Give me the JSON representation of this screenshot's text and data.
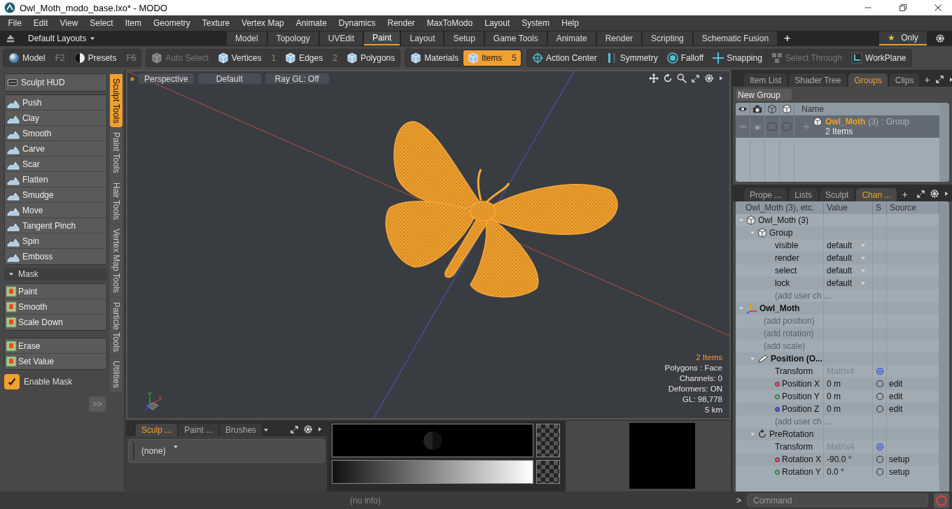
{
  "window": {
    "title": "Owl_Moth_modo_base.lxo* - MODO"
  },
  "menu": [
    "File",
    "Edit",
    "View",
    "Select",
    "Item",
    "Geometry",
    "Texture",
    "Vertex Map",
    "Animate",
    "Dynamics",
    "Render",
    "MaxToModo",
    "Layout",
    "System",
    "Help"
  ],
  "layout_bar": {
    "layouts": "Default Layouts",
    "tabs": [
      {
        "label": "Model",
        "selected": false
      },
      {
        "label": "Topology",
        "selected": false
      },
      {
        "label": "UVEdit",
        "selected": false
      },
      {
        "label": "Paint",
        "selected": true
      },
      {
        "label": "Layout",
        "selected": false
      },
      {
        "label": "Setup",
        "selected": false
      },
      {
        "label": "Game Tools",
        "selected": false
      },
      {
        "label": "Animate",
        "selected": false
      },
      {
        "label": "Render",
        "selected": false
      },
      {
        "label": "Scripting",
        "selected": false
      },
      {
        "label": "Schematic Fusion",
        "selected": false
      }
    ],
    "add": "+",
    "filter": {
      "star": "★",
      "label": "Only",
      "selected": true
    }
  },
  "toolbar": [
    {
      "buttons": [
        {
          "label": "Model",
          "shortcut": "F2",
          "selected": false,
          "disabled": false
        },
        {
          "label": "Presets",
          "shortcut": "F6",
          "selected": false,
          "disabled": false
        }
      ]
    },
    {
      "buttons": [
        {
          "label": "Auto Select",
          "selected": false,
          "disabled": true
        },
        {
          "label": "Vertices",
          "shortcut": "1",
          "selected": false,
          "disabled": false
        },
        {
          "label": "Edges",
          "shortcut": "2",
          "selected": false,
          "disabled": false
        },
        {
          "label": "Polygons",
          "selected": false,
          "disabled": false
        }
      ]
    },
    {
      "buttons": [
        {
          "label": "Materials",
          "selected": false,
          "disabled": false
        },
        {
          "label": "Items",
          "shortcut": "5",
          "selected": true,
          "disabled": false
        }
      ]
    },
    {
      "buttons": [
        {
          "label": "Action Center",
          "selected": false,
          "disabled": false
        },
        {
          "label": "Symmetry",
          "selected": false,
          "disabled": false
        },
        {
          "label": "Falloff",
          "selected": false,
          "disabled": false
        },
        {
          "label": "Snapping",
          "selected": false,
          "disabled": false
        },
        {
          "label": "Select Through",
          "selected": false,
          "disabled": true
        },
        {
          "label": "WorkPlane",
          "selected": false,
          "disabled": false
        }
      ]
    }
  ],
  "sculpt_panel": {
    "hud": "Sculpt HUD",
    "tools": [
      "Push",
      "Clay",
      "Smooth",
      "Carve",
      "Scar",
      "Flatten",
      "Smudge",
      "Move",
      "Tangent Pinch",
      "Spin",
      "Emboss"
    ],
    "mask": {
      "label": "Mask",
      "expanded": true,
      "tools": [
        "Paint",
        "Smooth",
        "Scale Down"
      ]
    },
    "value_tools": [
      "Erase",
      "Set Value"
    ],
    "enable_mask": {
      "label": "Enable Mask",
      "checked": true
    },
    "more": ">>"
  },
  "tool_tabs": [
    {
      "label": "Sculpt Tools",
      "selected": true
    },
    {
      "label": "Paint Tools",
      "selected": false
    },
    {
      "label": "Hair Tools",
      "selected": false
    },
    {
      "label": "Vertex Map Tools",
      "selected": false
    },
    {
      "label": "Particle Tools",
      "selected": false
    },
    {
      "label": "Utilities",
      "selected": false
    }
  ],
  "viewport": {
    "buttons": [
      "Perspective",
      "Default",
      "Ray GL: Off"
    ],
    "gizmo": [
      "Y",
      "X"
    ],
    "info": [
      {
        "text": "2 Items",
        "highlight": true
      },
      {
        "text": "Polygons : Face",
        "highlight": false
      },
      {
        "text": "Channels: 0",
        "highlight": false
      },
      {
        "text": "Deformers: ON",
        "highlight": false
      },
      {
        "text": "GL: 98,778",
        "highlight": false
      },
      {
        "text": "5 km",
        "highlight": false
      }
    ]
  },
  "brush_panel": {
    "tabs": [
      {
        "label": "Sculp ...",
        "selected": true
      },
      {
        "label": "Paint ...",
        "selected": false
      },
      {
        "label": "Brushes",
        "selected": false
      }
    ],
    "brush": "(none)"
  },
  "groups_panel": {
    "tabs": [
      {
        "label": "Item List",
        "selected": false
      },
      {
        "label": "Shader Tree",
        "selected": false
      },
      {
        "label": "Groups",
        "selected": true
      },
      {
        "label": "Clips",
        "selected": false
      }
    ],
    "add": "+",
    "new_group": "New Group",
    "column": "Name",
    "rows": [
      {
        "name": "Owl_Moth",
        "count": "(3)",
        "type": ": Group",
        "detail": "2 Items"
      }
    ]
  },
  "channels_panel": {
    "tabs": [
      {
        "label": "Prope ...",
        "selected": false
      },
      {
        "label": "Lists",
        "selected": false
      },
      {
        "label": "Sculpt",
        "selected": false
      },
      {
        "label": "Chan ...",
        "selected": true
      }
    ],
    "add": "+",
    "columns": [
      "Owl_Moth (3), etc.",
      "Value",
      "S",
      "Source"
    ],
    "rows": [
      {
        "label": "Owl_Moth (3)",
        "kind": "group",
        "expanded": true,
        "children": [
          {
            "label": "Group",
            "kind": "group",
            "expanded": true,
            "children": [
              {
                "label": "visible",
                "kind": "enum",
                "value": "default"
              },
              {
                "label": "render",
                "kind": "enum",
                "value": "default"
              },
              {
                "label": "select",
                "kind": "enum",
                "value": "default"
              },
              {
                "label": "lock",
                "kind": "enum",
                "value": "default"
              },
              {
                "label": "(add user ch ...",
                "kind": "placeholder"
              }
            ]
          }
        ]
      },
      {
        "label": "Owl_Moth",
        "kind": "locator",
        "expanded": true,
        "children": [
          {
            "label": "(add position)",
            "kind": "placeholder"
          },
          {
            "label": "(add rotation)",
            "kind": "placeholder"
          },
          {
            "label": "(add scale)",
            "kind": "placeholder"
          },
          {
            "label": "Position (O...",
            "kind": "translate",
            "expanded": true,
            "children": [
              {
                "label": "Transform",
                "kind": "matrix",
                "value": "Matrix4"
              },
              {
                "label": "Position X",
                "kind": "channel",
                "color": "#e0506a",
                "value": "0 m",
                "source": "edit"
              },
              {
                "label": "Position Y",
                "kind": "channel",
                "color": "#60c070",
                "value": "0 m",
                "source": "edit"
              },
              {
                "label": "Position Z",
                "kind": "channel",
                "color": "#5060e0",
                "value": "0 m",
                "source": "edit"
              },
              {
                "label": "(add user ch ...",
                "kind": "placeholder"
              }
            ]
          },
          {
            "label": "PreRotation",
            "kind": "rotate",
            "expanded": true,
            "children": [
              {
                "label": "Transform",
                "kind": "matrix",
                "value": "Matrix4"
              },
              {
                "label": "Rotation X",
                "kind": "channel",
                "color": "#e0506a",
                "value": "-90.0 °",
                "source": "setup"
              },
              {
                "label": "Rotation Y",
                "kind": "channel",
                "color": "#60c070",
                "value": "0.0 °",
                "source": "setup"
              }
            ]
          }
        ]
      }
    ]
  },
  "status_bar": {
    "info": "(no info)",
    "prompt": ">",
    "command_placeholder": "Command"
  }
}
